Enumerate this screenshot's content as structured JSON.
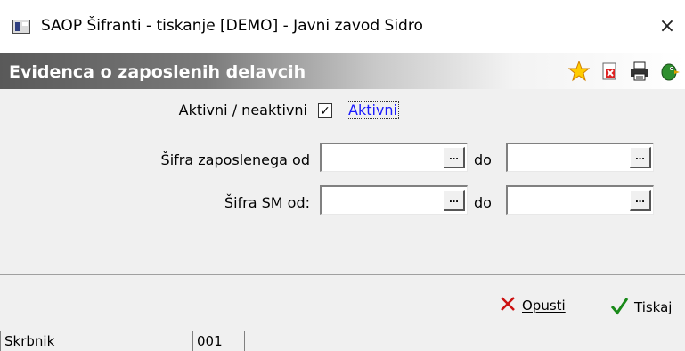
{
  "window": {
    "title": "SAOP Šifranti - tiskanje [DEMO] - Javni zavod Sidro",
    "close_glyph": "×"
  },
  "header": {
    "title": "Evidenca o zaposlenih delavcih",
    "icons": [
      "star-icon",
      "delete-icon",
      "printer-icon",
      "parrot-icon"
    ]
  },
  "form": {
    "active": {
      "label": "Aktivni / neaktivni",
      "checked": true,
      "check_label": "Aktivni"
    },
    "employee_code": {
      "label": "Šifra zaposlenega od",
      "to_label": "do",
      "from_value": "",
      "to_value": ""
    },
    "sm_code": {
      "label": "Šifra SM od:",
      "to_label": "do",
      "from_value": "",
      "to_value": ""
    },
    "ellipsis": "..."
  },
  "buttons": {
    "cancel": "Opusti",
    "print": "Tiskaj"
  },
  "status": {
    "user": "Skrbnik",
    "code": "001",
    "extra": ""
  },
  "colors": {
    "header_dark": "#595959",
    "link_blue": "#1a1aff",
    "cancel_red": "#cc1111",
    "ok_green": "#1a8a1a"
  }
}
